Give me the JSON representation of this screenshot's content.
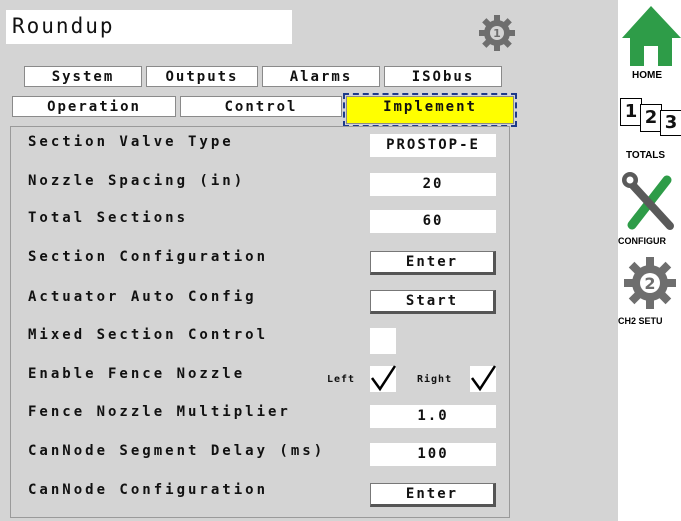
{
  "header": {
    "title": "Roundup",
    "gear_badge": "1"
  },
  "tabs_row1": [
    {
      "label": "System"
    },
    {
      "label": "Outputs"
    },
    {
      "label": "Alarms"
    },
    {
      "label": "ISObus"
    }
  ],
  "tabs_row2": [
    {
      "label": "Operation"
    },
    {
      "label": "Control"
    },
    {
      "label": "Implement",
      "active": true
    }
  ],
  "rows": {
    "section_valve_type": {
      "label": "Section Valve Type",
      "value": "PROSTOP-E"
    },
    "nozzle_spacing": {
      "label": "Nozzle Spacing (in)",
      "value": "20"
    },
    "total_sections": {
      "label": "Total Sections",
      "value": "60"
    },
    "section_configuration": {
      "label": "Section Configuration",
      "button": "Enter"
    },
    "actuator_auto_config": {
      "label": "Actuator Auto Config",
      "button": "Start"
    },
    "mixed_section_control": {
      "label": "Mixed Section Control",
      "checked": false
    },
    "enable_fence_nozzle": {
      "label": "Enable Fence Nozzle",
      "left_label": "Left",
      "right_label": "Right",
      "left_checked": true,
      "right_checked": true
    },
    "fence_nozzle_multiplier": {
      "label": "Fence Nozzle Multiplier",
      "value": "1.0"
    },
    "cannode_segment_delay": {
      "label": "CanNode Segment Delay (ms)",
      "value": "100"
    },
    "cannode_configuration": {
      "label": "CanNode Configuration",
      "button": "Enter"
    }
  },
  "sidebar": {
    "home": {
      "label": "HOME"
    },
    "totals": {
      "label": "TOTALS",
      "digits": [
        "1",
        "2",
        "3"
      ]
    },
    "configure": {
      "label": "CONFIGUR"
    },
    "ch2_setup": {
      "label": "CH2 SETU",
      "badge": "2"
    }
  },
  "colors": {
    "active_tab": "#ffff00",
    "panel_bg": "#d4d4d4",
    "home_green": "#2e9c48",
    "icon_gray": "#6e6e6e"
  }
}
